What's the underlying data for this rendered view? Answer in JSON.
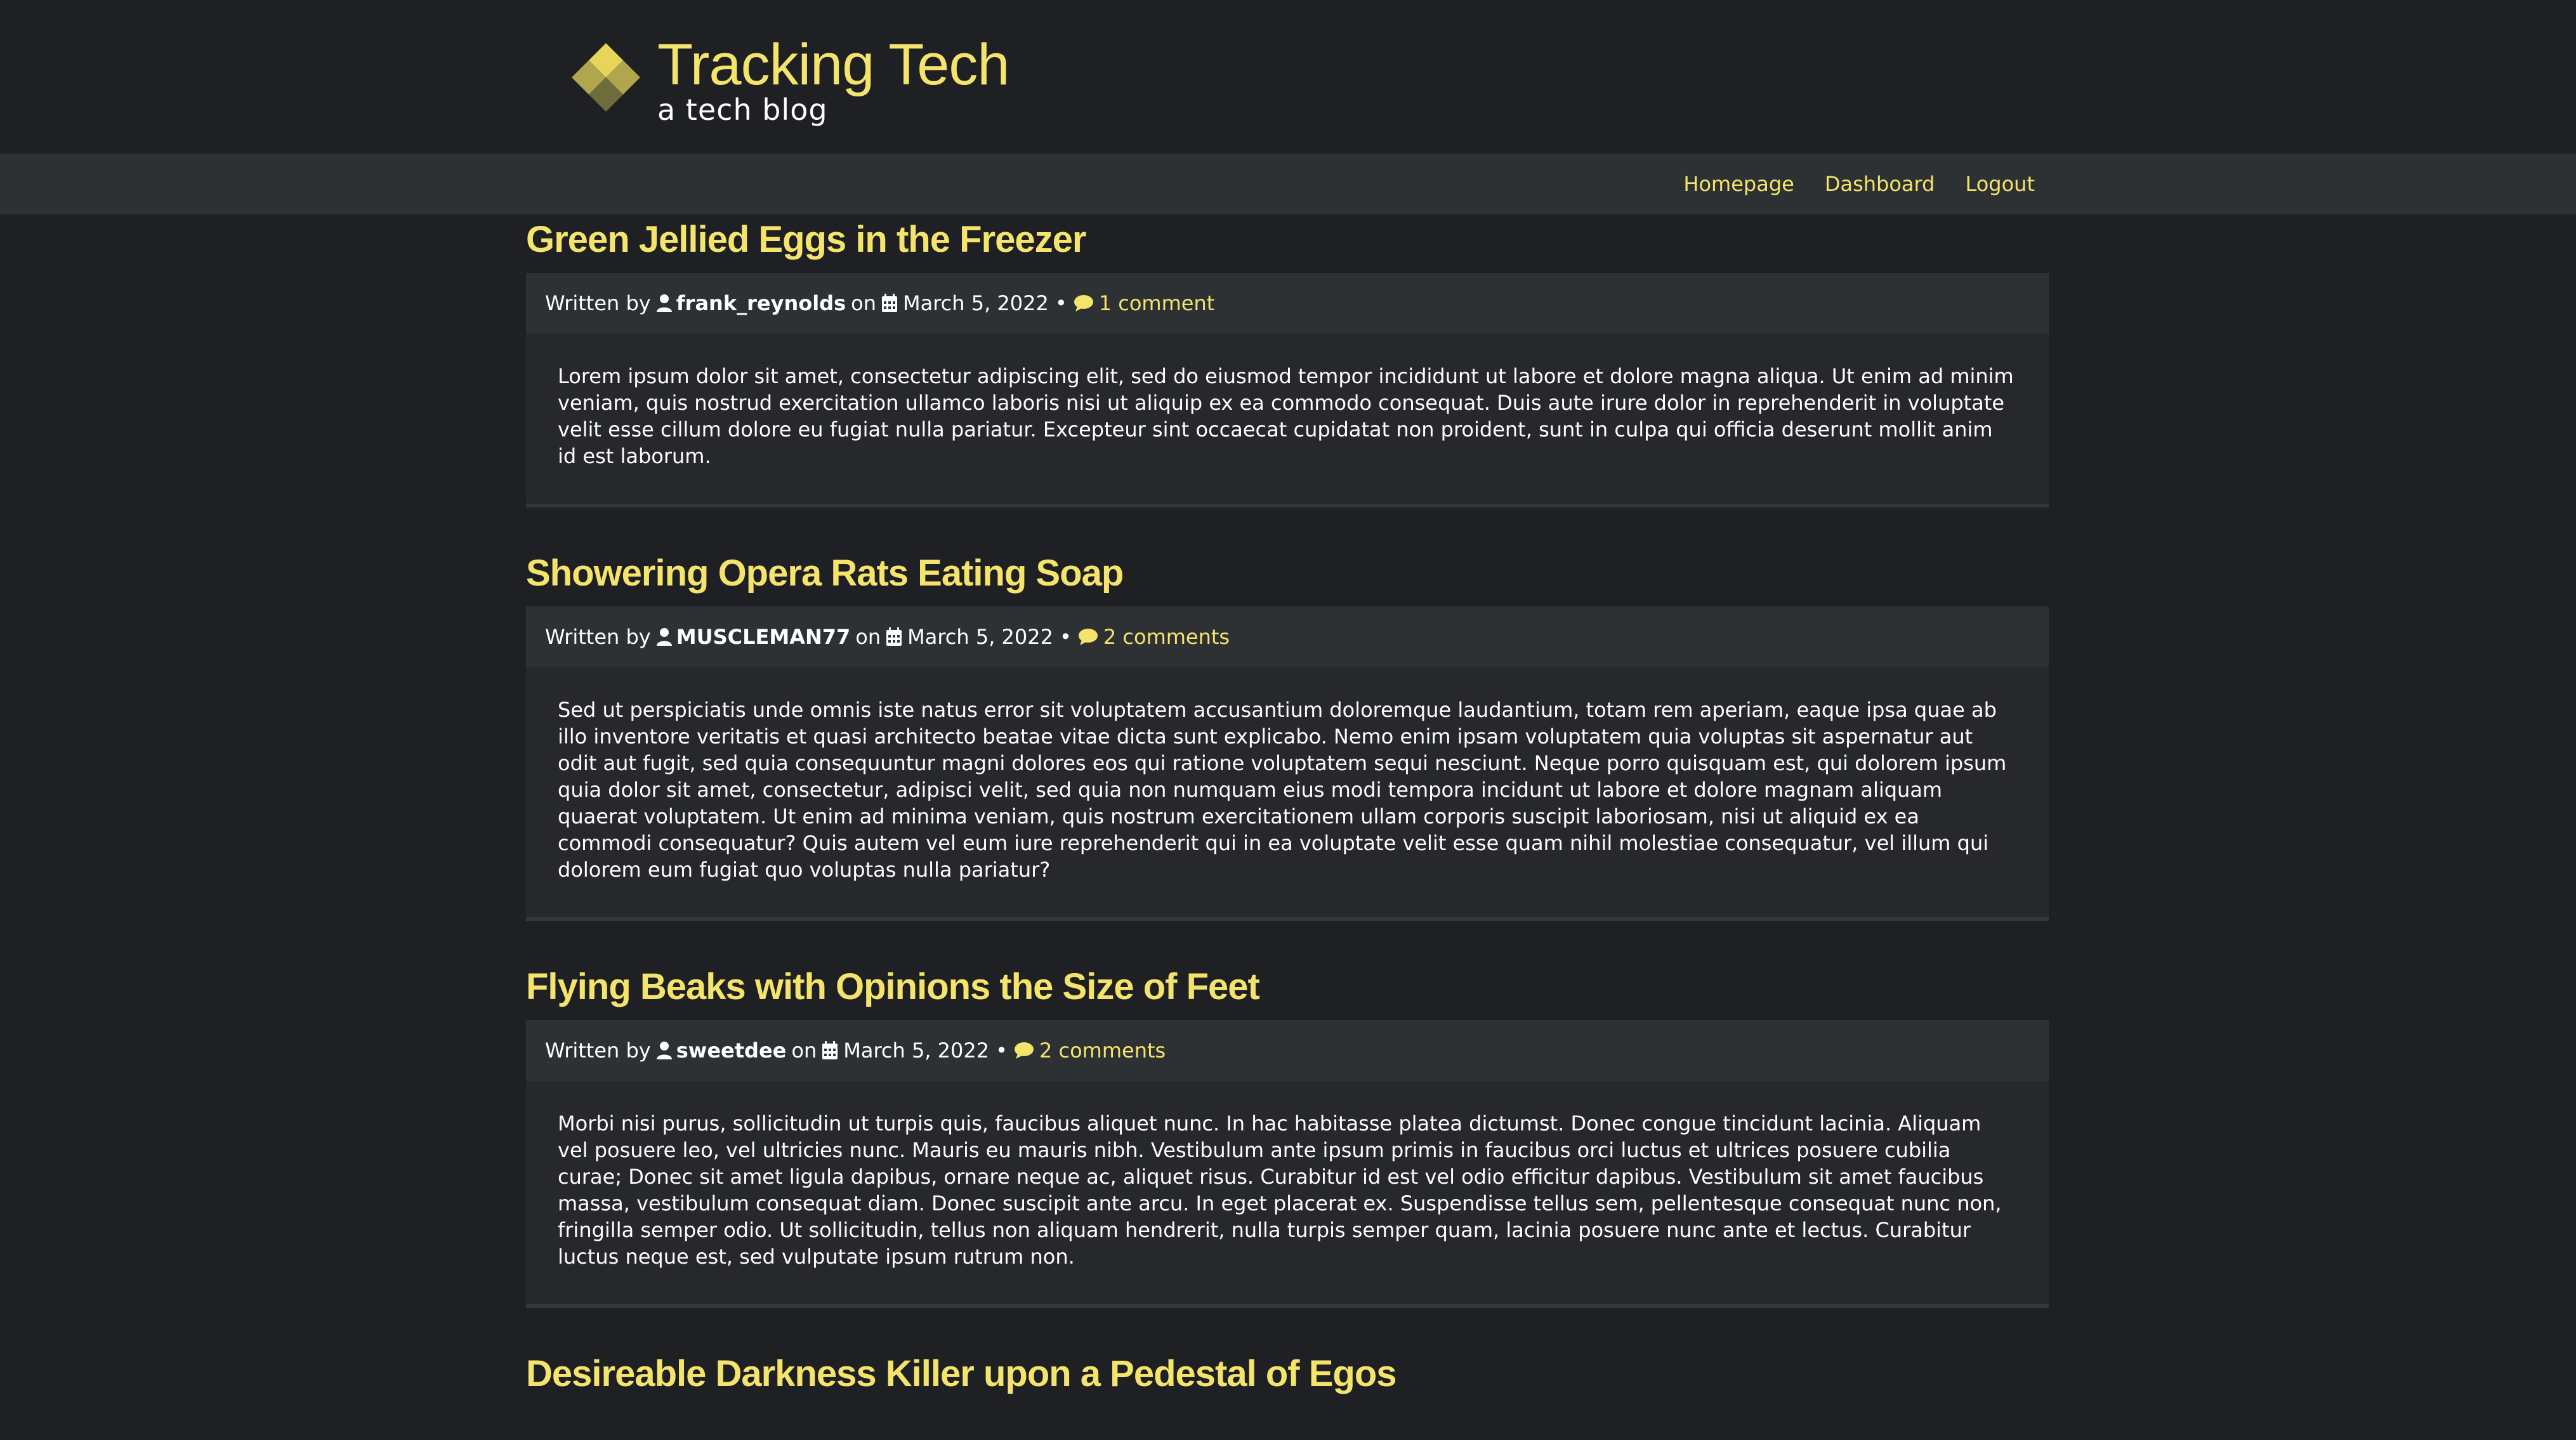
{
  "brand": {
    "title": "Tracking Tech",
    "subtitle": "a tech blog",
    "colors": {
      "accent": "#f4e46c",
      "logo_light": "#e7d55a",
      "logo_dark": "#8b8545"
    }
  },
  "nav": {
    "items": [
      {
        "label": "Homepage"
      },
      {
        "label": "Dashboard"
      },
      {
        "label": "Logout"
      }
    ]
  },
  "labels": {
    "written_by": "Written by",
    "on": "on",
    "bullet": "•"
  },
  "posts": [
    {
      "title": "Green Jellied Eggs in the Freezer",
      "author": "frank_reynolds",
      "date": "March 5, 2022",
      "comments": "1 comment",
      "body": "Lorem ipsum dolor sit amet, consectetur adipiscing elit, sed do eiusmod tempor incididunt ut labore et dolore magna aliqua. Ut enim ad minim veniam, quis nostrud exercitation ullamco laboris nisi ut aliquip ex ea commodo consequat. Duis aute irure dolor in reprehenderit in voluptate velit esse cillum dolore eu fugiat nulla pariatur. Excepteur sint occaecat cupidatat non proident, sunt in culpa qui officia deserunt mollit anim id est laborum."
    },
    {
      "title": "Showering Opera Rats Eating Soap",
      "author": "MUSCLEMAN77",
      "date": "March 5, 2022",
      "comments": "2 comments",
      "body": "Sed ut perspiciatis unde omnis iste natus error sit voluptatem accusantium doloremque laudantium, totam rem aperiam, eaque ipsa quae ab illo inventore veritatis et quasi architecto beatae vitae dicta sunt explicabo. Nemo enim ipsam voluptatem quia voluptas sit aspernatur aut odit aut fugit, sed quia consequuntur magni dolores eos qui ratione voluptatem sequi nesciunt. Neque porro quisquam est, qui dolorem ipsum quia dolor sit amet, consectetur, adipisci velit, sed quia non numquam eius modi tempora incidunt ut labore et dolore magnam aliquam quaerat voluptatem. Ut enim ad minima veniam, quis nostrum exercitationem ullam corporis suscipit laboriosam, nisi ut aliquid ex ea commodi consequatur? Quis autem vel eum iure reprehenderit qui in ea voluptate velit esse quam nihil molestiae consequatur, vel illum qui dolorem eum fugiat quo voluptas nulla pariatur?"
    },
    {
      "title": "Flying Beaks with Opinions the Size of Feet",
      "author": "sweetdee",
      "date": "March 5, 2022",
      "comments": "2 comments",
      "body": "Morbi nisi purus, sollicitudin ut turpis quis, faucibus aliquet nunc. In hac habitasse platea dictumst. Donec congue tincidunt lacinia. Aliquam vel posuere leo, vel ultricies nunc. Mauris eu mauris nibh. Vestibulum ante ipsum primis in faucibus orci luctus et ultrices posuere cubilia curae; Donec sit amet ligula dapibus, ornare neque ac, aliquet risus. Curabitur id est vel odio efficitur dapibus. Vestibulum sit amet faucibus massa, vestibulum consequat diam. Donec suscipit ante arcu. In eget placerat ex. Suspendisse tellus sem, pellentesque consequat nunc non, fringilla semper odio. Ut sollicitudin, tellus non aliquam hendrerit, nulla turpis semper quam, lacinia posuere nunc ante et lectus. Curabitur luctus neque est, sed vulputate ipsum rutrum non."
    },
    {
      "title": "Desireable Darkness Killer upon a Pedestal of Egos"
    }
  ],
  "icons": {
    "author": "user-icon",
    "date": "calendar-icon",
    "comments": "comment-icon"
  }
}
